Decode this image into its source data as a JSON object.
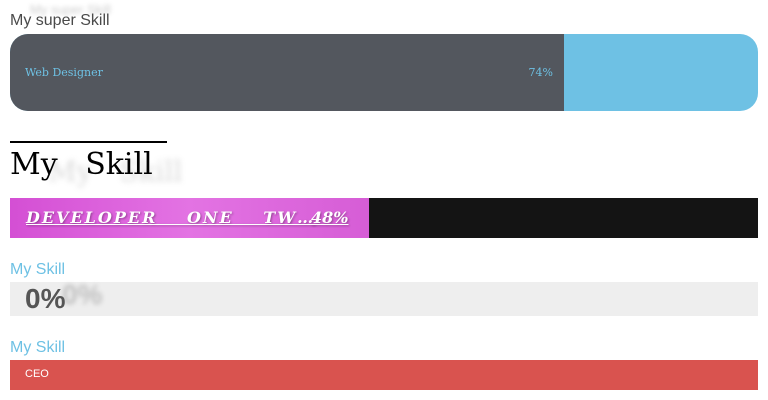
{
  "skills": [
    {
      "label": "My super Skill",
      "ghost_label": "My super Skill",
      "inner_title": "Web Designer",
      "percent_text": "74%",
      "value": 0.74,
      "fill_color": "#53575e",
      "track_color": "#6ec1e4"
    },
    {
      "label": "My Skill",
      "inner_title": "DEVELOPER ONE TW…",
      "percent_text": "48%",
      "value": 0.48,
      "fill_color": "#df6adf",
      "track_color": "#141414"
    },
    {
      "label": "My Skill",
      "percent_text": "0%",
      "value": 0.0,
      "track_color": "#eeeeee"
    },
    {
      "label": "My Skill",
      "inner_title": "CEO",
      "value": 1.0,
      "fill_color": "#d9534f"
    }
  ]
}
